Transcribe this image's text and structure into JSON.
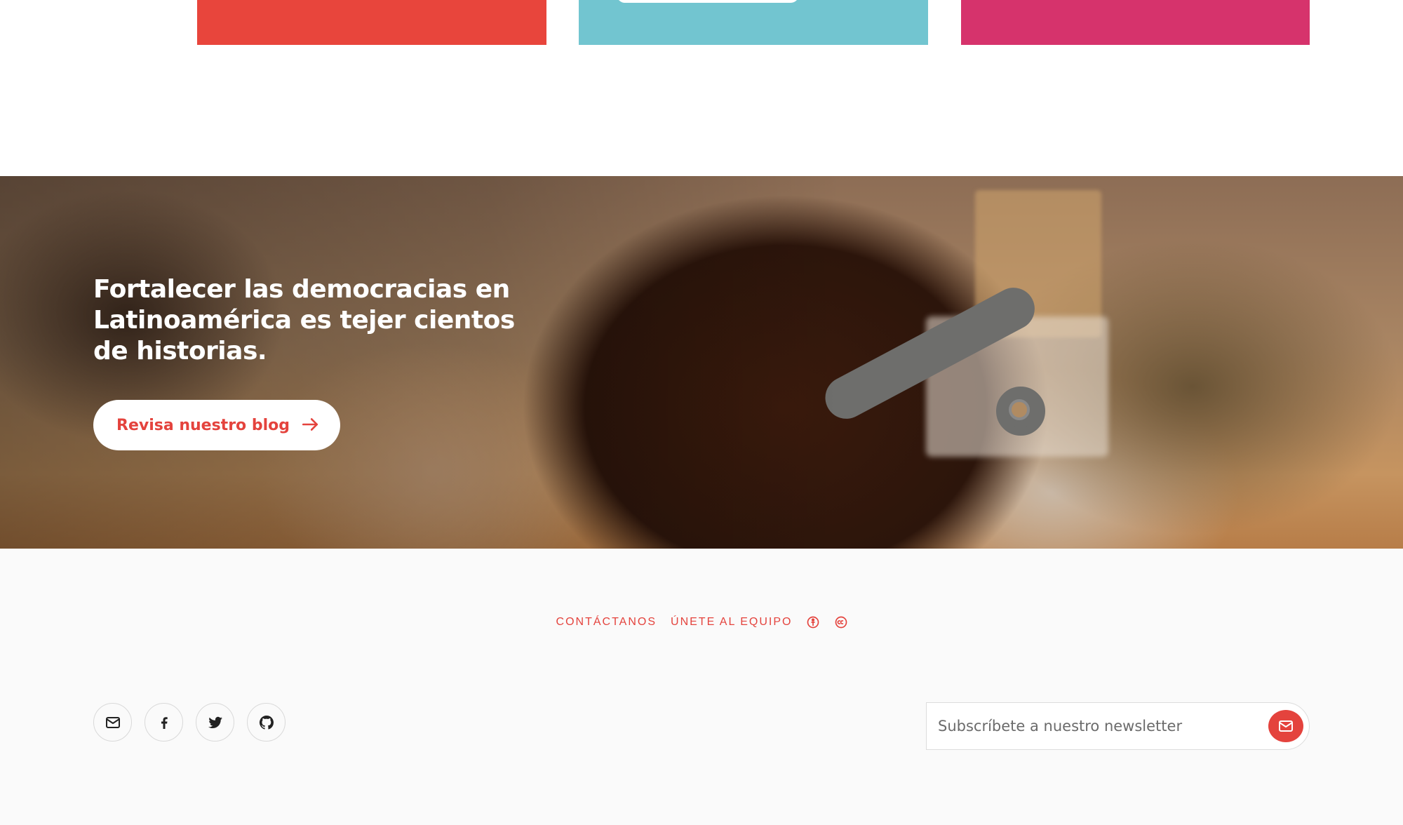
{
  "colors": {
    "card_red": "#e8453c",
    "card_teal": "#72c5d0",
    "card_pink": "#d6336c",
    "accent": "#e4433d",
    "footer_bg": "#fafafa"
  },
  "hero": {
    "headline": "Fortalecer las democracias en Latinoamérica es tejer cientos de historias.",
    "button_label": "Revisa nuestro blog",
    "button_icon": "arrow-right-icon"
  },
  "footer": {
    "links": [
      {
        "label": "CONTÁCTANOS"
      },
      {
        "label": "ÚNETE AL EQUIPO"
      }
    ],
    "link_icons": [
      "open-source-icon",
      "creative-commons-icon"
    ],
    "socials": [
      "mail-icon",
      "facebook-icon",
      "twitter-icon",
      "github-icon"
    ],
    "newsletter": {
      "placeholder": "Subscríbete a nuestro newsletter",
      "submit_icon": "mail-icon"
    }
  }
}
